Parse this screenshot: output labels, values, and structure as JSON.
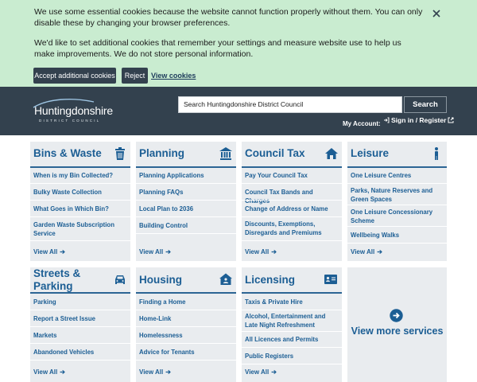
{
  "cookie": {
    "text1": "We use some essential cookies because the website cannot function properly without them. You can only disable these by changing your browser preferences.",
    "text2": "We'd like to set additional cookies that remember your settings and measure website use to help us make improvements. We do not store personal information.",
    "accept_label": "Accept additional cookies",
    "reject_label": "Reject",
    "view_label": "View cookies"
  },
  "header": {
    "logo_name": "Huntingdonshire",
    "logo_sub": "DISTRICT COUNCIL",
    "search_placeholder": "Search Huntingdonshire District Council",
    "search_button": "Search",
    "account_label": "My Account:",
    "signin_label": "Sign in / Register"
  },
  "cards": {
    "bins": {
      "title": "Bins & Waste",
      "links": [
        "When is my Bin Collected?",
        "Bulky Waste Collection",
        "What Goes in Which Bin?",
        "Garden Waste Subscription Service"
      ],
      "viewall": "View All"
    },
    "planning": {
      "title": "Planning",
      "links": [
        "Planning Applications",
        "Planning FAQs",
        "Local Plan to 2036",
        "Building Control"
      ],
      "viewall": "View All"
    },
    "counciltax": {
      "title": "Council Tax",
      "links": [
        "Pay Your Council Tax",
        "Council Tax Bands and Charges",
        "Change of Address or Name",
        "Discounts, Exemptions, Disregards and Premiums"
      ],
      "viewall": "View All"
    },
    "leisure": {
      "title": "Leisure",
      "links": [
        "One Leisure Centres",
        "Parks, Nature Reserves and Green Spaces",
        "One Leisure Concessionary Scheme",
        "Wellbeing Walks"
      ],
      "viewall": "View All"
    },
    "streets": {
      "title": "Streets & Parking",
      "links": [
        "Parking",
        "Report a Street Issue",
        "Markets",
        "Abandoned Vehicles"
      ],
      "viewall": "View All"
    },
    "housing": {
      "title": "Housing",
      "links": [
        "Finding a Home",
        "Home-Link",
        "Homelessness",
        "Advice for Tenants"
      ],
      "viewall": "View All"
    },
    "licensing": {
      "title": "Licensing",
      "links": [
        "Taxis & Private Hire",
        "Alcohol, Entertainment and Late Night Refreshment",
        "All Licences and Permits",
        "Public Registers"
      ],
      "viewall": "View All"
    }
  },
  "more": {
    "label": "View more services"
  },
  "colors": {
    "header_bg": "#33414e",
    "accent": "#1c5e94",
    "cookie_bg": "#c9ecd0",
    "card_bg": "#e9ecef"
  },
  "icons": [
    "close-icon",
    "external-link-icon",
    "bin-icon",
    "building-icon",
    "house-icon",
    "person-icon",
    "car-icon",
    "home-icon",
    "id-card-icon",
    "arrow-circle-icon"
  ]
}
